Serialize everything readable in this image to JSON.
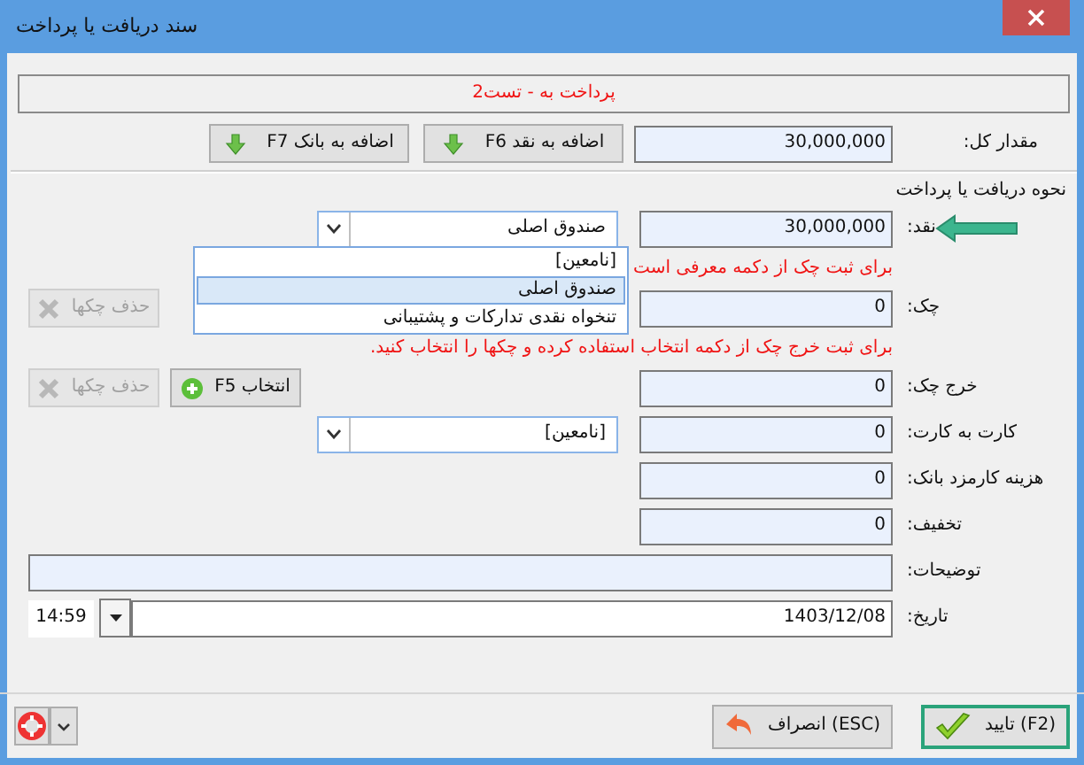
{
  "window": {
    "title": "سند دریافت یا پرداخت"
  },
  "header": {
    "text": "پرداخت به - تست2"
  },
  "total": {
    "label": "مقدار کل:",
    "value": "30,000,000",
    "buttons": [
      {
        "label": "اضافه به نقد F6"
      },
      {
        "label": "اضافه به بانک F7"
      }
    ]
  },
  "section_title": "نحوه دریافت یا پرداخت",
  "rows": [
    {
      "kind": "combo",
      "label": "نقد:",
      "value": "30,000,000",
      "combo": "صندوق اصلی",
      "pointer": true
    },
    {
      "kind": "hint",
      "text": "برای ثبت چک از دکمه معرفی است"
    },
    {
      "kind": "buttons",
      "label": "چک:",
      "value": "0",
      "buttons": [
        {
          "kind": "remove",
          "label": "حذف چکها",
          "disabled": true
        }
      ]
    },
    {
      "kind": "hint",
      "text": "برای ثبت خرج چک از دکمه انتخاب استفاده کرده و چکها را انتخاب کنید."
    },
    {
      "kind": "buttons",
      "label": "خرج چک:",
      "value": "0",
      "buttons": [
        {
          "kind": "add",
          "label": "انتخاب F5",
          "disabled": false
        },
        {
          "kind": "remove",
          "label": "حذف چکها",
          "disabled": true
        }
      ]
    },
    {
      "kind": "combo",
      "label": "کارت به کارت:",
      "value": "0",
      "combo": "[نامعین]",
      "pointer": false
    },
    {
      "kind": "plain",
      "label": "هزینه کارمزد بانک:",
      "value": "0"
    },
    {
      "kind": "plain",
      "label": "تخفیف:",
      "value": "0"
    },
    {
      "kind": "notes",
      "label": "توضیحات:"
    },
    {
      "kind": "date",
      "label": "تاریخ:",
      "value": "1403/12/08",
      "time": "14:59"
    }
  ],
  "dropdown": {
    "items": [
      {
        "label": "[نامعین]",
        "selected": false
      },
      {
        "label": "صندوق اصلی",
        "selected": true
      },
      {
        "label": "تنخواه نقدی تدارکات و پشتیبانی",
        "selected": false
      }
    ]
  },
  "footer": {
    "buttons": [
      {
        "kind": "ok",
        "label": "(F2) تایید",
        "focused": true
      },
      {
        "kind": "cancel",
        "label": "(ESC) انصراف",
        "focused": false
      }
    ]
  }
}
